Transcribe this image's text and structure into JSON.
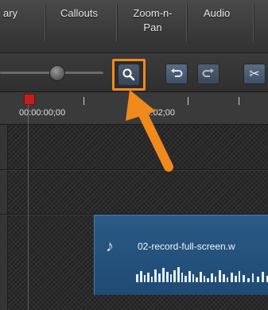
{
  "tabs": [
    {
      "label": "ary"
    },
    {
      "label": "Callouts"
    },
    {
      "label": "Zoom-n-\nPan"
    },
    {
      "label": "Audio"
    }
  ],
  "toolbar": {
    "zoom_icon": "magnifier-icon",
    "undo_icon": "undo-icon",
    "redo_icon": "redo-icon",
    "cut_icon": "scissors-icon"
  },
  "ruler": {
    "time_start": "00:00:00;00",
    "time_mid": "0:00:02;00"
  },
  "clip": {
    "name": "02-record-full-screen.w",
    "icon": "music-note-icon"
  },
  "colors": {
    "highlight": "#f08a1c",
    "clip": "#1f4a73",
    "playhead": "#c41f1f"
  }
}
